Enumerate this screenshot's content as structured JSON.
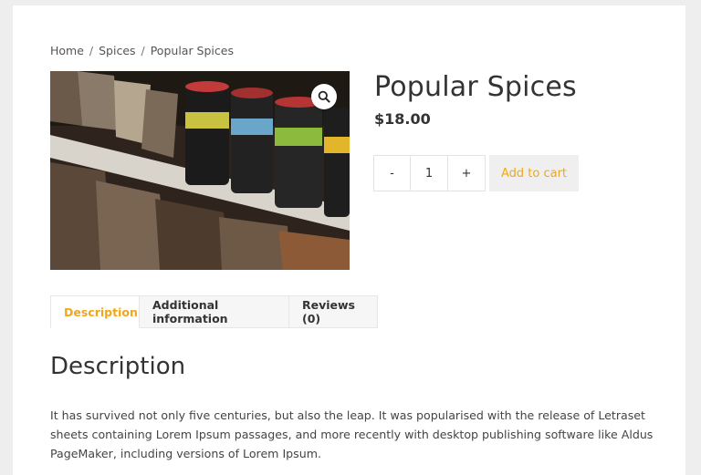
{
  "breadcrumb": {
    "items": [
      "Home",
      "Spices",
      "Popular Spices"
    ],
    "separator": "/"
  },
  "product": {
    "title": "Popular Spices",
    "price": "$18.00",
    "image_icon": "magnifier-icon"
  },
  "cart": {
    "minus_label": "-",
    "quantity": "1",
    "plus_label": "+",
    "add_label": "Add to cart"
  },
  "tabs": [
    {
      "label": "Description",
      "active": true
    },
    {
      "label": "Additional information",
      "active": false
    },
    {
      "label": "Reviews (0)",
      "active": false
    }
  ],
  "description": {
    "heading": "Description",
    "text": "It has survived not only five centuries, but also the leap. It was popularised with the release of Letraset sheets containing Lorem Ipsum passages, and more recently with desktop publishing software like Aldus PageMaker, including versions of Lorem Ipsum."
  },
  "colors": {
    "accent": "#f0a81a",
    "page_bg": "#eeeeee",
    "card_bg": "#ffffff"
  }
}
